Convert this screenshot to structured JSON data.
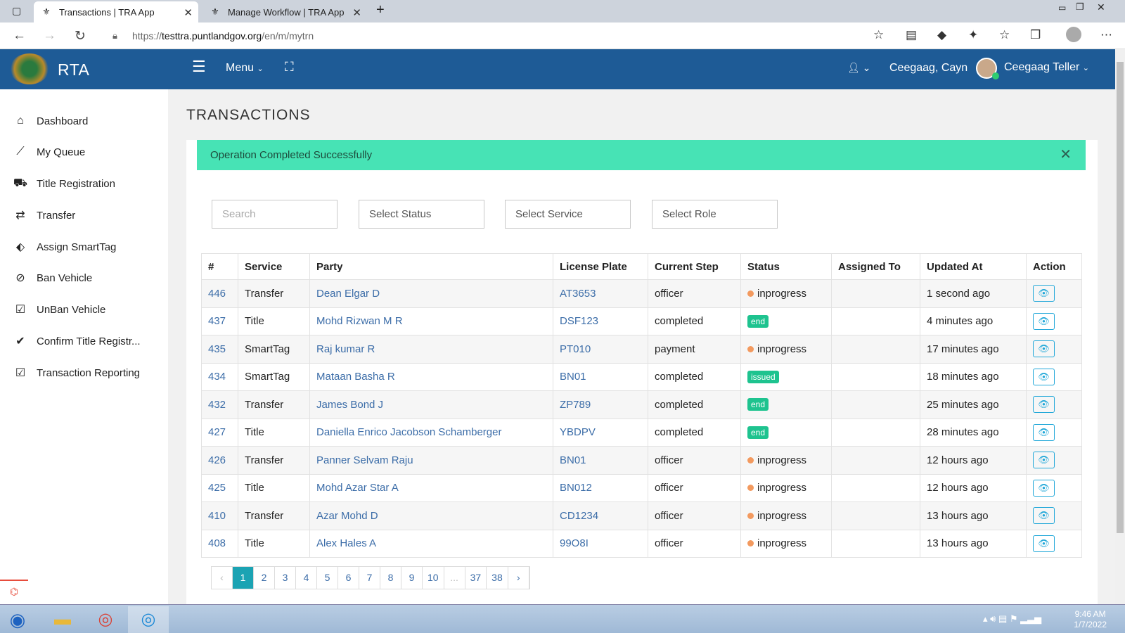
{
  "browser": {
    "tabs": [
      {
        "title": "Transactions | TRA App"
      },
      {
        "title": "Manage Workflow | TRA App"
      }
    ],
    "url_prefix": "https://",
    "url_domain": "testtra.puntlandgov.org",
    "url_path": "/en/m/mytrn"
  },
  "header": {
    "brand": "RTA",
    "menu_label": "Menu",
    "username_short": "Ceegaag, Cayn",
    "user_role": "Ceegaag Teller"
  },
  "sidebar": {
    "items": [
      {
        "label": "Dashboard",
        "icon": "home-icon"
      },
      {
        "label": "My Queue",
        "icon": "trend-icon"
      },
      {
        "label": "Title Registration",
        "icon": "car-icon"
      },
      {
        "label": "Transfer",
        "icon": "exchange-icon"
      },
      {
        "label": "Assign SmartTag",
        "icon": "tags-icon"
      },
      {
        "label": "Ban Vehicle",
        "icon": "ban-icon"
      },
      {
        "label": "UnBan Vehicle",
        "icon": "check-square-icon"
      },
      {
        "label": "Confirm Title Registr...",
        "icon": "check-icon"
      },
      {
        "label": "Transaction Reporting",
        "icon": "check-square-icon"
      }
    ]
  },
  "main": {
    "title": "TRANSACTIONS",
    "alert": "Operation Completed Successfully",
    "filters": {
      "search_placeholder": "Search",
      "status": "Select Status",
      "service": "Select Service",
      "role": "Select Role"
    },
    "columns": [
      "#",
      "Service",
      "Party",
      "License Plate",
      "Current Step",
      "Status",
      "Assigned To",
      "Updated At",
      "Action"
    ],
    "rows": [
      {
        "id": "446",
        "service": "Transfer",
        "party": "Dean Elgar D",
        "plate": "AT3653",
        "step": "officer",
        "status": "inprogress",
        "badge": "",
        "assigned": "",
        "updated": "1 second ago"
      },
      {
        "id": "437",
        "service": "Title",
        "party": "Mohd Rizwan M R",
        "plate": "DSF123",
        "step": "completed",
        "status": "",
        "badge": "end",
        "assigned": "",
        "updated": "4 minutes ago"
      },
      {
        "id": "435",
        "service": "SmartTag",
        "party": "Raj kumar R",
        "plate": "PT010",
        "step": "payment",
        "status": "inprogress",
        "badge": "",
        "assigned": "",
        "updated": "17 minutes ago"
      },
      {
        "id": "434",
        "service": "SmartTag",
        "party": "Mataan Basha R",
        "plate": "BN01",
        "step": "completed",
        "status": "",
        "badge": "issued",
        "assigned": "",
        "updated": "18 minutes ago"
      },
      {
        "id": "432",
        "service": "Transfer",
        "party": "James Bond J",
        "plate": "ZP789",
        "step": "completed",
        "status": "",
        "badge": "end",
        "assigned": "",
        "updated": "25 minutes ago"
      },
      {
        "id": "427",
        "service": "Title",
        "party": "Daniella Enrico Jacobson Schamberger",
        "plate": "YBDPV",
        "step": "completed",
        "status": "",
        "badge": "end",
        "assigned": "",
        "updated": "28 minutes ago"
      },
      {
        "id": "426",
        "service": "Transfer",
        "party": "Panner Selvam Raju",
        "plate": "BN01",
        "step": "officer",
        "status": "inprogress",
        "badge": "",
        "assigned": "",
        "updated": "12 hours ago"
      },
      {
        "id": "425",
        "service": "Title",
        "party": "Mohd Azar Star A",
        "plate": "BN012",
        "step": "officer",
        "status": "inprogress",
        "badge": "",
        "assigned": "",
        "updated": "12 hours ago"
      },
      {
        "id": "410",
        "service": "Transfer",
        "party": "Azar Mohd D",
        "plate": "CD1234",
        "step": "officer",
        "status": "inprogress",
        "badge": "",
        "assigned": "",
        "updated": "13 hours ago"
      },
      {
        "id": "408",
        "service": "Title",
        "party": "Alex Hales A",
        "plate": "99O8I",
        "step": "officer",
        "status": "inprogress",
        "badge": "",
        "assigned": "",
        "updated": "13 hours ago"
      }
    ],
    "pagination": {
      "prev": "‹",
      "pages": [
        "1",
        "2",
        "3",
        "4",
        "5",
        "6",
        "7",
        "8",
        "9",
        "10",
        "...",
        "37",
        "38"
      ],
      "next": "›",
      "active": "1"
    }
  },
  "taskbar": {
    "time": "9:46 AM",
    "date": "1/7/2022"
  },
  "colors": {
    "header": "#1e5b96",
    "alert": "#47e3b5",
    "badge": "#1ec38f",
    "dot": "#f39a5f",
    "active_page": "#1ba3b3"
  }
}
